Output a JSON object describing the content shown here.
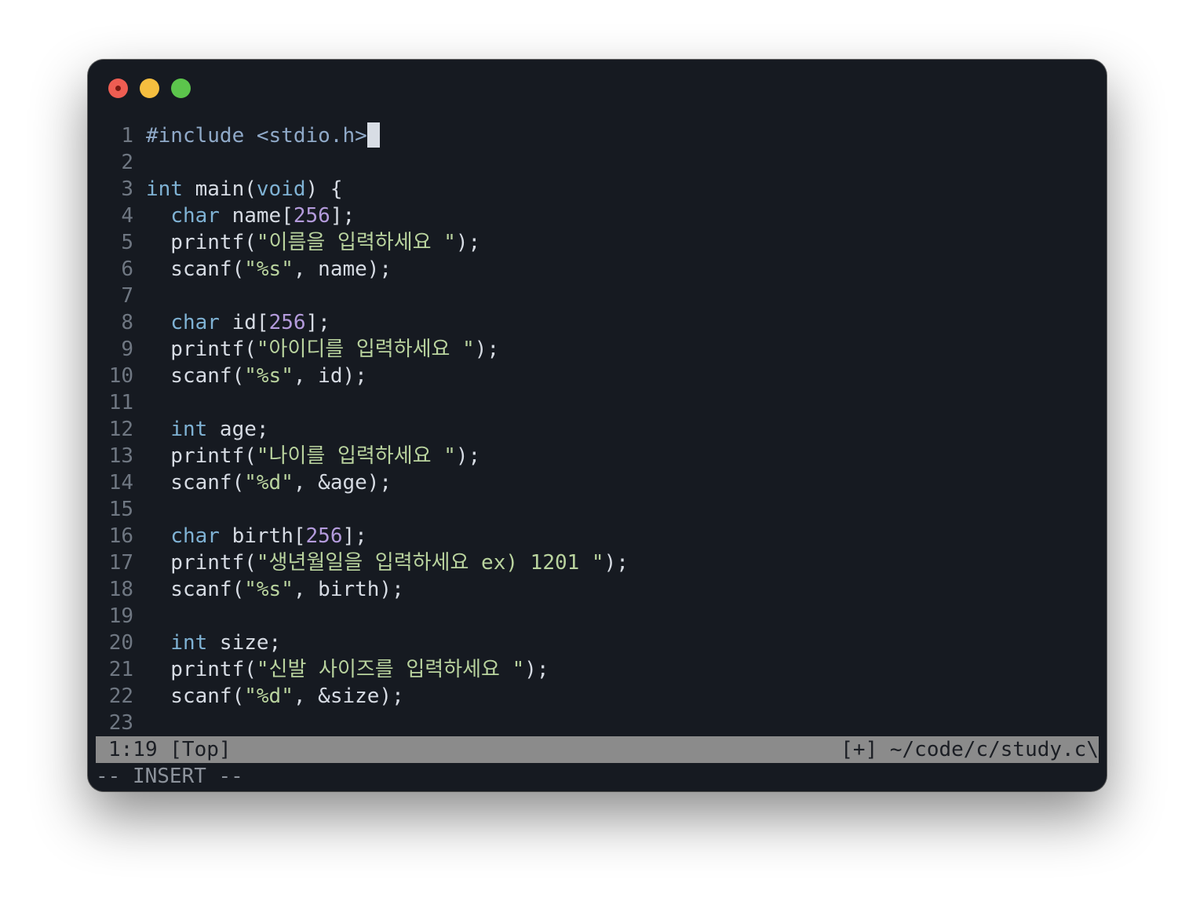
{
  "window": {
    "controls": [
      "close",
      "minimize",
      "maximize"
    ]
  },
  "editor": {
    "lines": [
      {
        "n": "1",
        "tokens": [
          {
            "t": "#include <stdio.h>",
            "c": "pp"
          }
        ],
        "cursor": true
      },
      {
        "n": "2",
        "tokens": []
      },
      {
        "n": "3",
        "tokens": [
          {
            "t": "int",
            "c": "kw"
          },
          {
            "t": " main("
          },
          {
            "t": "void",
            "c": "kw"
          },
          {
            "t": ") {"
          }
        ]
      },
      {
        "n": "4",
        "tokens": [
          {
            "t": "  "
          },
          {
            "t": "char",
            "c": "kw"
          },
          {
            "t": " name["
          },
          {
            "t": "256",
            "c": "num"
          },
          {
            "t": "];"
          }
        ]
      },
      {
        "n": "5",
        "tokens": [
          {
            "t": "  printf("
          },
          {
            "t": "\"이름을 입력하세요 \"",
            "c": "str"
          },
          {
            "t": ");"
          }
        ]
      },
      {
        "n": "6",
        "tokens": [
          {
            "t": "  scanf("
          },
          {
            "t": "\"%s\"",
            "c": "str"
          },
          {
            "t": ", name);"
          }
        ]
      },
      {
        "n": "7",
        "tokens": []
      },
      {
        "n": "8",
        "tokens": [
          {
            "t": "  "
          },
          {
            "t": "char",
            "c": "kw"
          },
          {
            "t": " id["
          },
          {
            "t": "256",
            "c": "num"
          },
          {
            "t": "];"
          }
        ]
      },
      {
        "n": "9",
        "tokens": [
          {
            "t": "  printf("
          },
          {
            "t": "\"아이디를 입력하세요 \"",
            "c": "str"
          },
          {
            "t": ");"
          }
        ]
      },
      {
        "n": "10",
        "tokens": [
          {
            "t": "  scanf("
          },
          {
            "t": "\"%s\"",
            "c": "str"
          },
          {
            "t": ", id);"
          }
        ]
      },
      {
        "n": "11",
        "tokens": []
      },
      {
        "n": "12",
        "tokens": [
          {
            "t": "  "
          },
          {
            "t": "int",
            "c": "kw"
          },
          {
            "t": " age;"
          }
        ]
      },
      {
        "n": "13",
        "tokens": [
          {
            "t": "  printf("
          },
          {
            "t": "\"나이를 입력하세요 \"",
            "c": "str"
          },
          {
            "t": ");"
          }
        ]
      },
      {
        "n": "14",
        "tokens": [
          {
            "t": "  scanf("
          },
          {
            "t": "\"%d\"",
            "c": "str"
          },
          {
            "t": ", &age);"
          }
        ]
      },
      {
        "n": "15",
        "tokens": []
      },
      {
        "n": "16",
        "tokens": [
          {
            "t": "  "
          },
          {
            "t": "char",
            "c": "kw"
          },
          {
            "t": " birth["
          },
          {
            "t": "256",
            "c": "num"
          },
          {
            "t": "];"
          }
        ]
      },
      {
        "n": "17",
        "tokens": [
          {
            "t": "  printf("
          },
          {
            "t": "\"생년월일을 입력하세요 ex) 1201 \"",
            "c": "str"
          },
          {
            "t": ");"
          }
        ]
      },
      {
        "n": "18",
        "tokens": [
          {
            "t": "  scanf("
          },
          {
            "t": "\"%s\"",
            "c": "str"
          },
          {
            "t": ", birth);"
          }
        ]
      },
      {
        "n": "19",
        "tokens": []
      },
      {
        "n": "20",
        "tokens": [
          {
            "t": "  "
          },
          {
            "t": "int",
            "c": "kw"
          },
          {
            "t": " size;"
          }
        ]
      },
      {
        "n": "21",
        "tokens": [
          {
            "t": "  printf("
          },
          {
            "t": "\"신발 사이즈를 입력하세요 \"",
            "c": "str"
          },
          {
            "t": ");"
          }
        ]
      },
      {
        "n": "22",
        "tokens": [
          {
            "t": "  scanf("
          },
          {
            "t": "\"%d\"",
            "c": "str"
          },
          {
            "t": ", &size);"
          }
        ]
      },
      {
        "n": "23",
        "tokens": []
      }
    ]
  },
  "statusbar": {
    "position": "1:19 [Top]",
    "file": "[+] ~/code/c/study.c\\"
  },
  "mode": "-- INSERT --",
  "colors": {
    "background": "#161a21",
    "keyword": "#7fb2d4",
    "number": "#b49bdc",
    "string": "#b9d39e",
    "statusbar": "#8b8b8b"
  }
}
